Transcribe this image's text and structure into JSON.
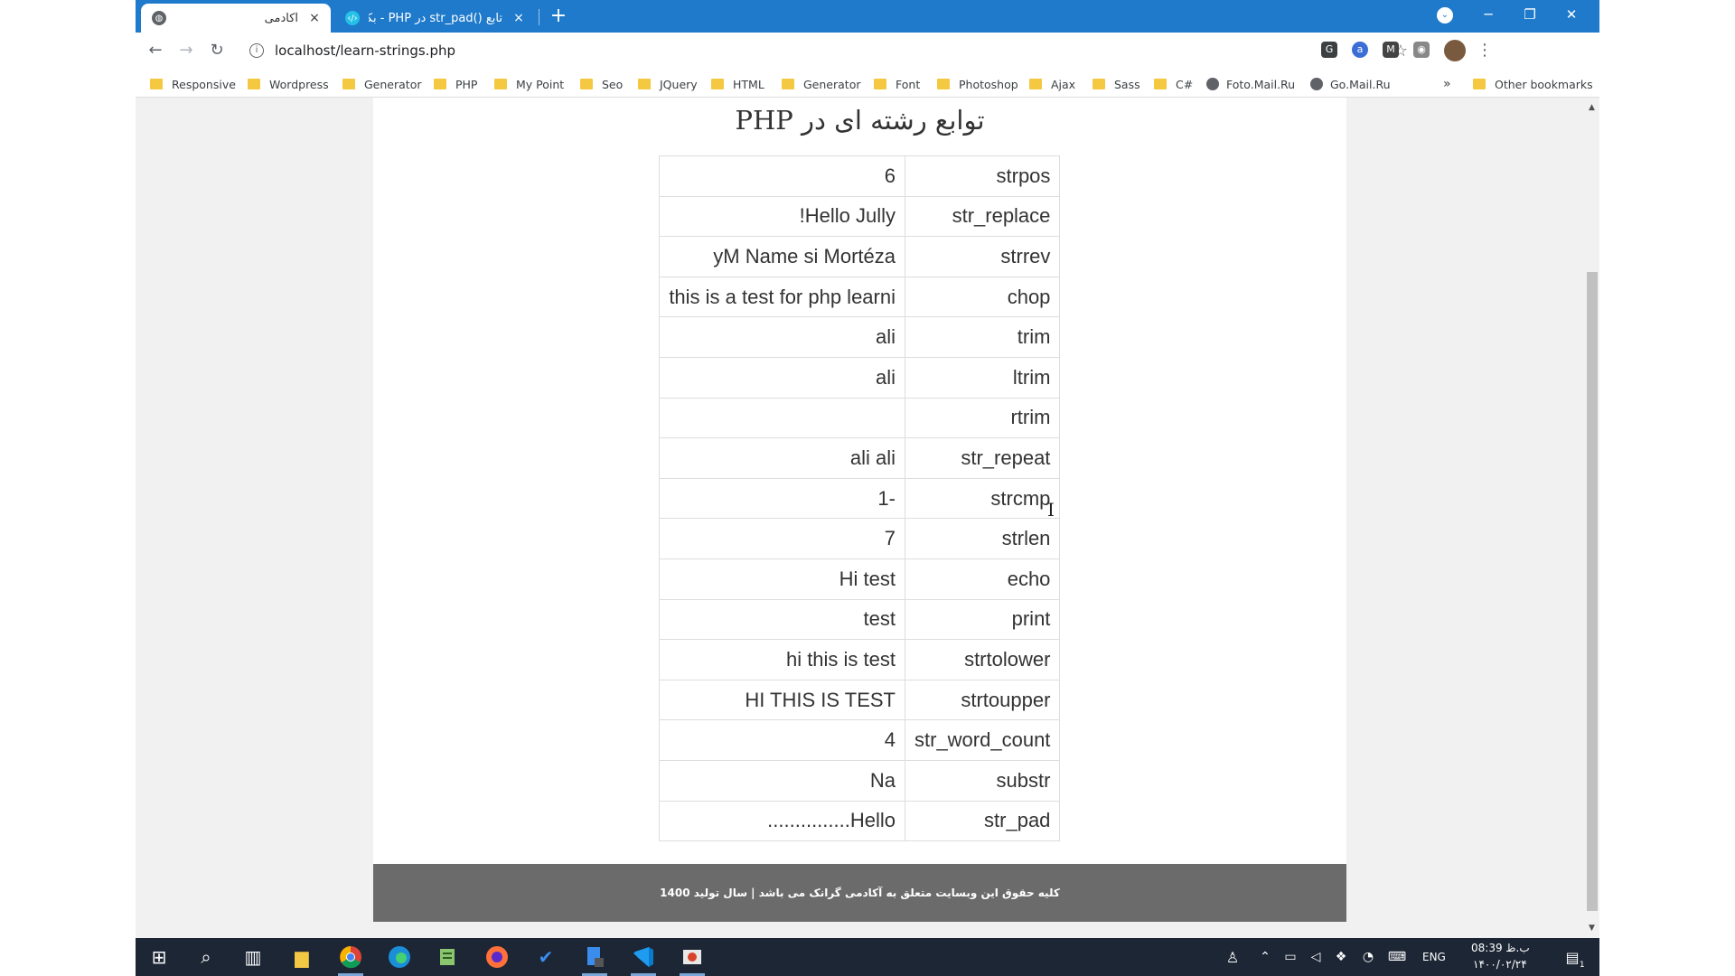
{
  "browser": {
    "tabs": [
      {
        "title": "آکادمی",
        "close": "×"
      },
      {
        "title": "تابع ()str_pad در PHP - بکندباز",
        "close": "×"
      }
    ],
    "new_tab": "+",
    "window_controls": {
      "minimize": "─",
      "restore": "❐",
      "close": "✕"
    },
    "tab_search": "⌄",
    "nav": {
      "back": "←",
      "forward": "→",
      "reload": "↻"
    },
    "address": {
      "url": "localhost/learn-strings.php",
      "info": "i",
      "star": "☆"
    },
    "extensions": [
      "G",
      "a",
      "M",
      "◉",
      "●",
      "◘",
      "✱"
    ],
    "kebab": "⋮",
    "bookmarks": [
      "Responsive",
      "Wordpress",
      "Generator",
      "PHP",
      "My Point",
      "Seo",
      "JQuery",
      "HTML",
      "Generator",
      "Font",
      "Photoshop",
      "Ajax",
      "Sass",
      "C#"
    ],
    "bookmark_sites": [
      "Foto.Mail.Ru",
      "Go.Mail.Ru"
    ],
    "bookmarks_overflow": "»",
    "other_bookmarks": "Other bookmarks"
  },
  "page": {
    "title": "توابع رشته ای در PHP",
    "rows": [
      {
        "fn": "strpos",
        "val": "6"
      },
      {
        "fn": "str_replace",
        "val": "Hello Jully!"
      },
      {
        "fn": "strrev",
        "val": "yM Name si Mortéza"
      },
      {
        "fn": "chop",
        "val": "this is a test for php learni"
      },
      {
        "fn": "trim",
        "val": "ali"
      },
      {
        "fn": "ltrim",
        "val": "ali"
      },
      {
        "fn": "rtrim",
        "val": ""
      },
      {
        "fn": "str_repeat",
        "val": "ali ali"
      },
      {
        "fn": "strcmp",
        "val": "-1"
      },
      {
        "fn": "strlen",
        "val": "7"
      },
      {
        "fn": "echo",
        "val": "Hi test"
      },
      {
        "fn": "print",
        "val": "test"
      },
      {
        "fn": "strtolower",
        "val": "hi this is test"
      },
      {
        "fn": "strtoupper",
        "val": "HI THIS IS TEST"
      },
      {
        "fn": "str_word_count",
        "val": "4"
      },
      {
        "fn": "substr",
        "val": "Na"
      },
      {
        "fn": "str_pad",
        "val": "Hello..............."
      }
    ],
    "footer": "کلیه حقوق این وبسایت متعلق به آکادمی گرانک می باشد | سال تولید 1400"
  },
  "scrollbar": {
    "up": "▲",
    "down": "▼"
  },
  "taskbar": {
    "start": "⊞",
    "search": "⌕",
    "lang": "ENG",
    "time": "08:39 ب.ظ",
    "date": "۱۴۰۰/۰۲/۲۴",
    "notifications": "1"
  },
  "colors": {
    "tabstrip": "#1f7acb",
    "taskbar": "#1c2635",
    "footer": "#6b6b6b"
  }
}
